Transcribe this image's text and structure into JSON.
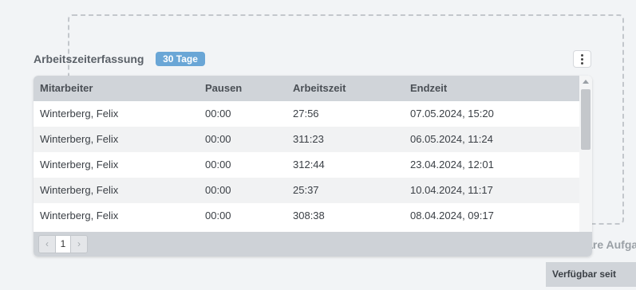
{
  "widget": {
    "title": "Arbeitszeiterfassung",
    "badge": "30 Tage",
    "menu_icon": "vertical-dots-icon"
  },
  "table": {
    "columns": [
      "Mitarbeiter",
      "Pausen",
      "Arbeitszeit",
      "Endzeit"
    ],
    "rows": [
      [
        "Winterberg, Felix",
        "00:00",
        "27:56",
        "07.05.2024, 15:20"
      ],
      [
        "Winterberg, Felix",
        "00:00",
        "311:23",
        "06.05.2024, 11:24"
      ],
      [
        "Winterberg, Felix",
        "00:00",
        "312:44",
        "23.04.2024, 12:01"
      ],
      [
        "Winterberg, Felix",
        "00:00",
        "25:37",
        "10.04.2024, 11:17"
      ],
      [
        "Winterberg, Felix",
        "00:00",
        "308:38",
        "08.04.2024, 09:17"
      ]
    ]
  },
  "pager": {
    "prev": "‹",
    "current": "1",
    "next": "›"
  },
  "background_widget": {
    "title": "Verfügbare Aufga",
    "column_header": "Verfügbar seit"
  },
  "colors": {
    "badge": "#6aa6d6",
    "header": "#d0d4d9"
  }
}
